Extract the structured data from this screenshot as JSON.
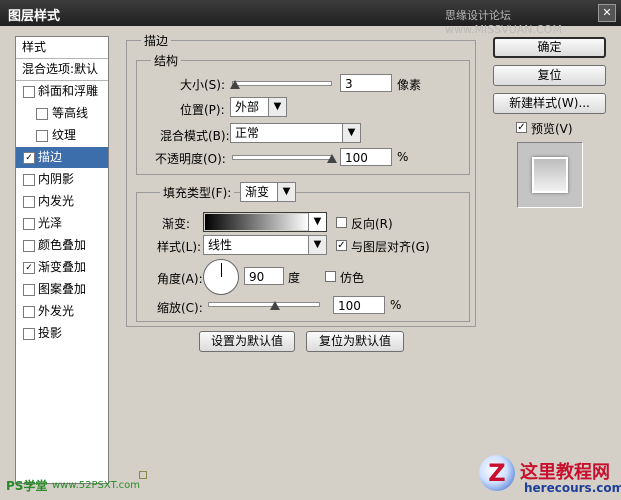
{
  "window": {
    "title": "图层样式",
    "watermark": "思缘设计论坛 www.MISSVUAN.COM"
  },
  "left_panel": {
    "header": "样式",
    "blend_header": "混合选项:默认",
    "items": [
      {
        "label": "斜面和浮雕",
        "checked": false,
        "indent": false,
        "selected": false
      },
      {
        "label": "等高线",
        "checked": false,
        "indent": true,
        "selected": false
      },
      {
        "label": "纹理",
        "checked": false,
        "indent": true,
        "selected": false
      },
      {
        "label": "描边",
        "checked": true,
        "indent": false,
        "selected": true
      },
      {
        "label": "内阴影",
        "checked": false,
        "indent": false,
        "selected": false
      },
      {
        "label": "内发光",
        "checked": false,
        "indent": false,
        "selected": false
      },
      {
        "label": "光泽",
        "checked": false,
        "indent": false,
        "selected": false
      },
      {
        "label": "颜色叠加",
        "checked": false,
        "indent": false,
        "selected": false
      },
      {
        "label": "渐变叠加",
        "checked": true,
        "indent": false,
        "selected": false
      },
      {
        "label": "图案叠加",
        "checked": false,
        "indent": false,
        "selected": false
      },
      {
        "label": "外发光",
        "checked": false,
        "indent": false,
        "selected": false
      },
      {
        "label": "投影",
        "checked": false,
        "indent": false,
        "selected": false
      }
    ]
  },
  "stroke": {
    "section_title": "描边",
    "structure_title": "结构",
    "size_label": "大小(S):",
    "size_value": "3",
    "size_unit": "像素",
    "position_label": "位置(P):",
    "position_value": "外部",
    "blend_mode_label": "混合模式(B):",
    "blend_mode_value": "正常",
    "opacity_label": "不透明度(O):",
    "opacity_value": "100",
    "opacity_unit": "%",
    "fill_type_label": "填充类型(F):",
    "fill_type_value": "渐变",
    "gradient_label": "渐变:",
    "reverse_label": "反向(R)",
    "reverse_checked": false,
    "style_label": "样式(L):",
    "style_value": "线性",
    "align_label": "与图层对齐(G)",
    "align_checked": true,
    "angle_label": "角度(A):",
    "angle_value": "90",
    "angle_unit": "度",
    "dither_label": "仿色",
    "dither_checked": false,
    "scale_label": "缩放(C):",
    "scale_value": "100",
    "scale_unit": "%",
    "set_default_label": "设置为默认值",
    "reset_default_label": "复位为默认值"
  },
  "right_buttons": {
    "ok": "确定",
    "reset": "复位",
    "new_style": "新建样式(W)...",
    "preview_label": "预览(V)",
    "preview_checked": true
  },
  "corner_marks": {
    "left": "PS学堂",
    "left_url": "www.52PSXT.com",
    "right_title": "这里教程网",
    "right_url": "herecours.com"
  },
  "colors": {
    "selection": "#3d6eac",
    "dialog_bg": "#d4d0c8",
    "title_bg": "#2a2a2a"
  },
  "icons": [
    "checkbox-icon",
    "dropdown-arrow-icon",
    "slider-thumb-icon",
    "angle-dial-icon",
    "close-icon",
    "site-logo-icon"
  ]
}
